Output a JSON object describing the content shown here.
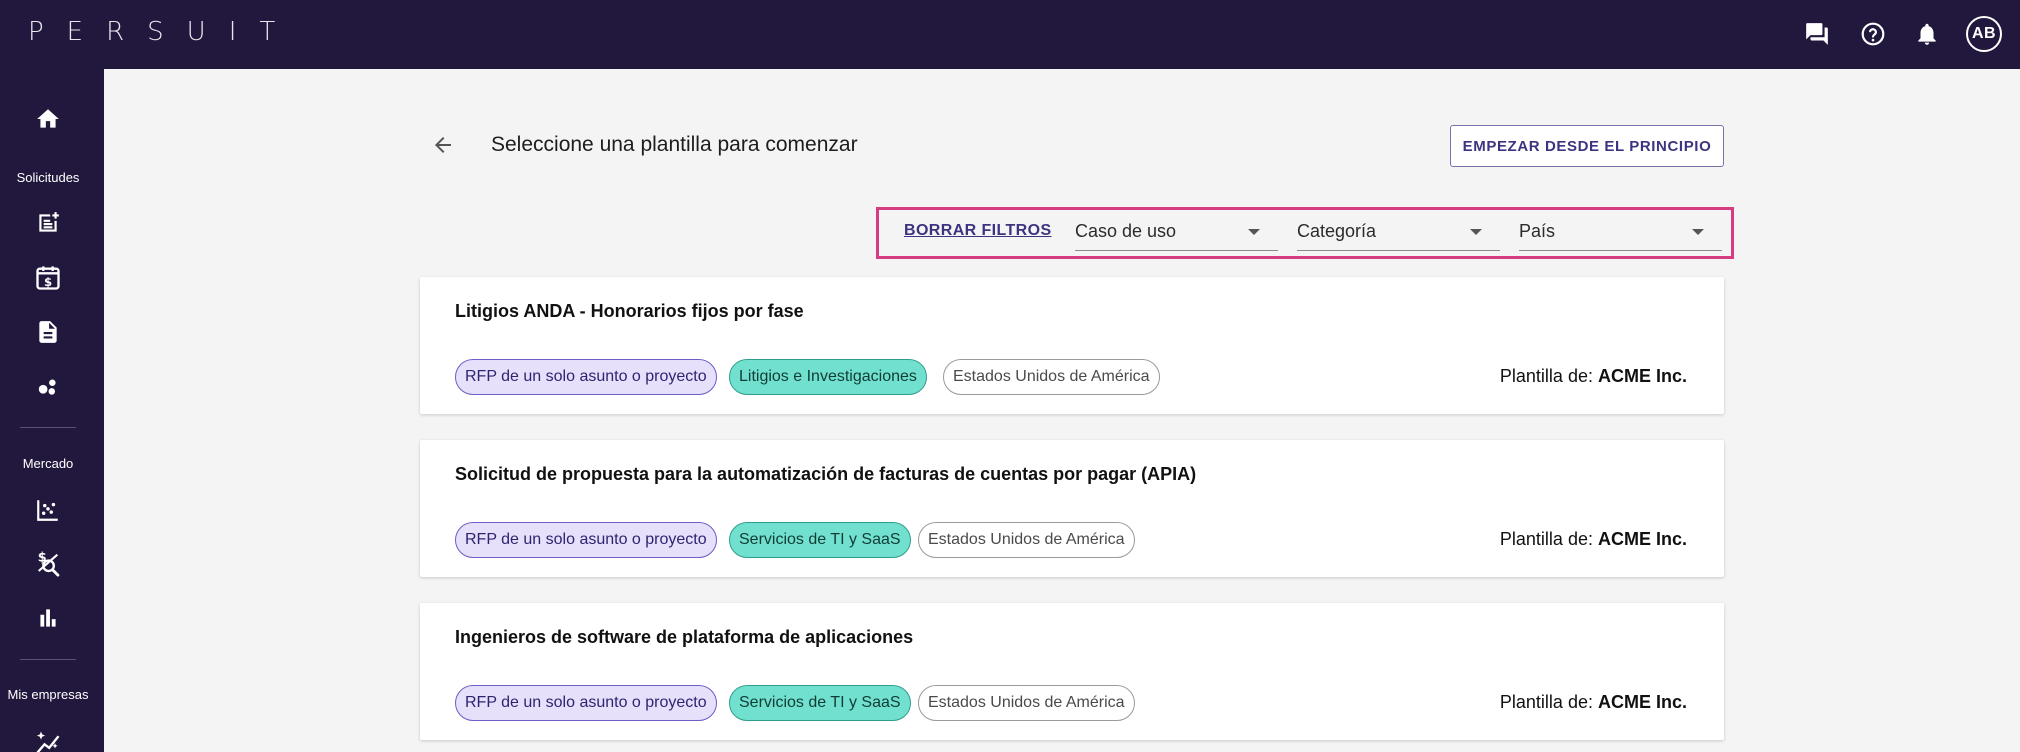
{
  "app": {
    "logo": "PERSUIT",
    "avatar": "AB"
  },
  "topbar_icons": [
    "chat-icon",
    "help-icon",
    "bell-icon"
  ],
  "sidebar": {
    "sections": [
      {
        "label": "Solicitudes"
      },
      {
        "label": "Mercado"
      },
      {
        "label": "Mis empresas"
      }
    ]
  },
  "header": {
    "title": "Seleccione una plantilla para comenzar",
    "start_button": "EMPEZAR DESDE EL PRINCIPIO"
  },
  "filters": {
    "clear": "BORRAR FILTROS",
    "use_case": "Caso de uso",
    "category": "Categoría",
    "country": "País"
  },
  "owner_prefix": "Plantilla de:",
  "templates": [
    {
      "title": "Litigios ANDA - Honorarios fijos por fase",
      "chips": [
        "RFP de un solo asunto o proyecto",
        "Litigios e Investigaciones",
        "Estados Unidos de América"
      ],
      "owner": "ACME Inc."
    },
    {
      "title": "Solicitud de propuesta para la automatización de facturas de cuentas por pagar (APIA)",
      "chips": [
        "RFP de un solo asunto o proyecto",
        "Servicios de TI y SaaS",
        "Estados Unidos de América"
      ],
      "owner": "ACME Inc."
    },
    {
      "title": "Ingenieros de software de plataforma de aplicaciones",
      "chips": [
        "RFP de un solo asunto o proyecto",
        "Servicios de TI y SaaS",
        "Estados Unidos de América"
      ],
      "owner": "ACME Inc."
    }
  ],
  "colors": {
    "nav_bg": "#22183d",
    "accent": "#3c3480",
    "filter_highlight": "#d63c82",
    "chip_purple": "#e6e0fb",
    "chip_teal": "#72e0ce"
  }
}
